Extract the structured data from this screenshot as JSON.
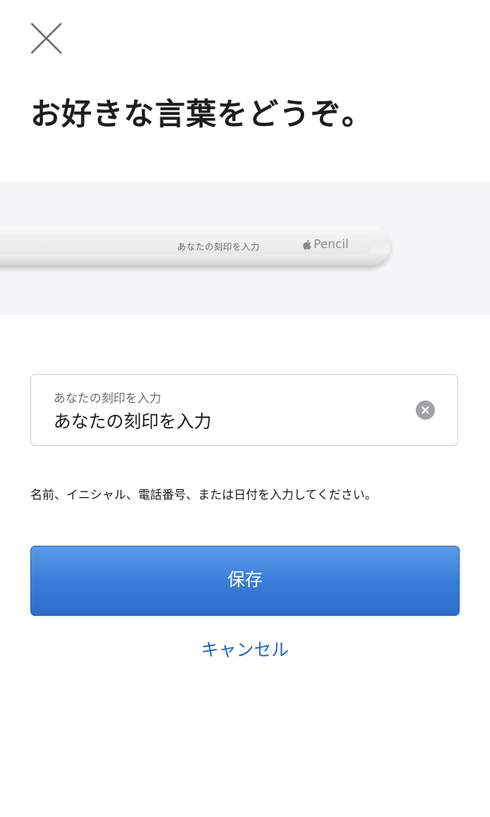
{
  "header": {
    "close_icon": "close-icon",
    "title": "お好きな言葉をどうぞ。"
  },
  "preview": {
    "engraving_text": "あなたの刻印を入力",
    "brand_text": "Pencil",
    "brand_icon": "apple-logo-icon"
  },
  "engraving_field": {
    "label": "あなたの刻印を入力",
    "value": "あなたの刻印を入力",
    "clear_icon": "clear-icon"
  },
  "helper_text": "名前、イニシャル、電話番号、または日付を入力してください。",
  "actions": {
    "save_label": "保存",
    "cancel_label": "キャンセル"
  },
  "colors": {
    "primary": "#3a7ed9",
    "link": "#1a66c7",
    "background": "#ffffff",
    "preview_background": "#f5f5f7"
  }
}
